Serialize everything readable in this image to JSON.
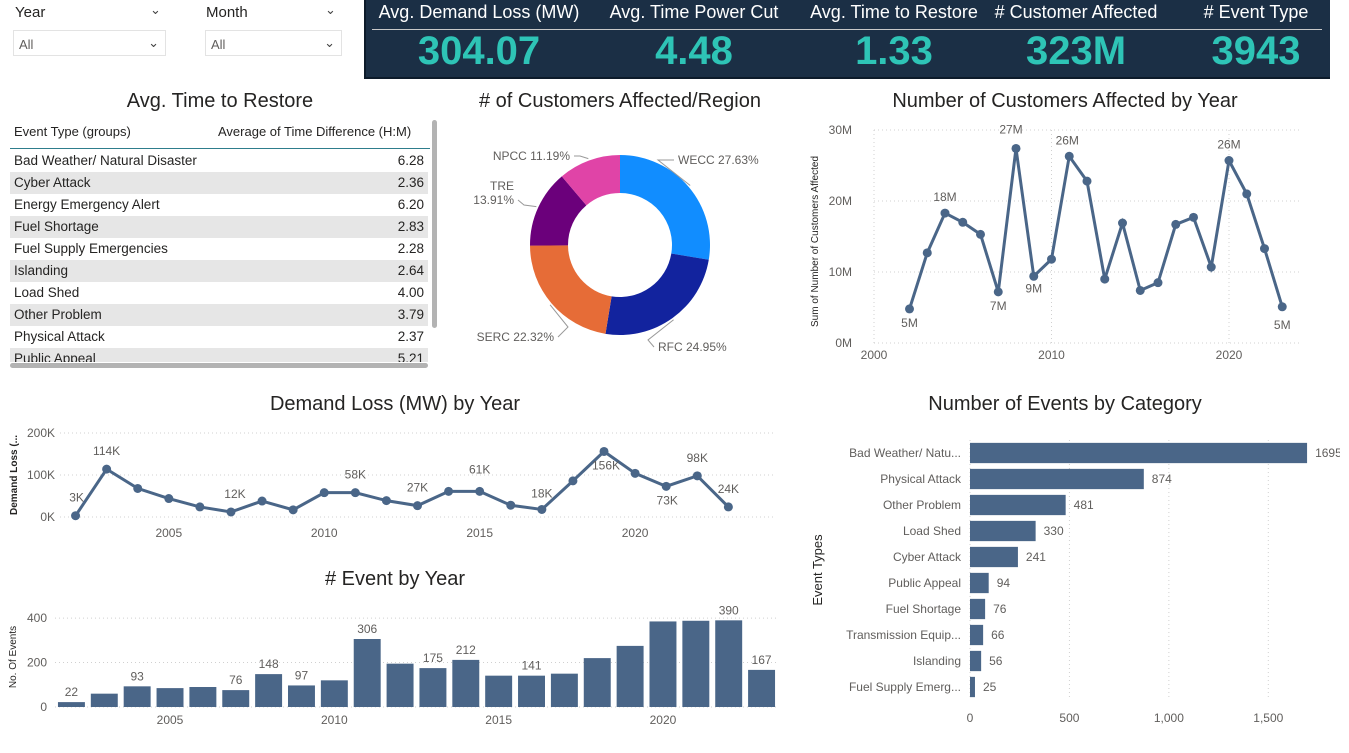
{
  "filters": {
    "year": {
      "label": "Year",
      "value": "All"
    },
    "month": {
      "label": "Month",
      "value": "All"
    }
  },
  "kpis": [
    {
      "label": "Avg. Demand Loss (MW)",
      "value": "304.07"
    },
    {
      "label": "Avg. Time Power Cut",
      "value": "4.48"
    },
    {
      "label": "Avg. Time to Restore",
      "value": "1.33"
    },
    {
      "label": "# Customer Affected",
      "value": "323M"
    },
    {
      "label": "# Event Type",
      "value": "3943"
    }
  ],
  "restore_table": {
    "title": "Avg. Time to Restore",
    "col1": "Event Type (groups)",
    "col2": "Average of Time Difference (H:M)",
    "rows": [
      {
        "name": "Bad Weather/ Natural Disaster",
        "value": "6.28"
      },
      {
        "name": "Cyber Attack",
        "value": "2.36"
      },
      {
        "name": "Energy Emergency Alert",
        "value": "6.20"
      },
      {
        "name": "Fuel Shortage",
        "value": "2.83"
      },
      {
        "name": "Fuel Supply Emergencies",
        "value": "2.28"
      },
      {
        "name": "Islanding",
        "value": "2.64"
      },
      {
        "name": "Load Shed",
        "value": "4.00"
      },
      {
        "name": "Other Problem",
        "value": "3.79"
      },
      {
        "name": "Physical Attack",
        "value": "2.37"
      },
      {
        "name": "Public Appeal",
        "value": "5.21"
      }
    ]
  },
  "chart_data": [
    {
      "id": "region_donut",
      "type": "pie",
      "title": "# of Customers Affected/Region",
      "slices": [
        {
          "name": "WECC",
          "label": "WECC 27.63%",
          "value": 27.63,
          "color": "#118dff"
        },
        {
          "name": "RFC",
          "label": "RFC 24.95%",
          "value": 24.95,
          "color": "#12239e"
        },
        {
          "name": "SERC",
          "label": "SERC 22.32%",
          "value": 22.32,
          "color": "#e66c37"
        },
        {
          "name": "TRE",
          "label": "TRE 13.91%",
          "value": 13.91,
          "color": "#6b007b"
        },
        {
          "name": "NPCC",
          "label": "NPCC 11.19%",
          "value": 11.19,
          "color": "#e044a7"
        }
      ],
      "legend": "none"
    },
    {
      "id": "customers_by_year",
      "type": "line",
      "title": "Number of Customers Affected by Year",
      "xlabel": "",
      "ylabel": "Sum of Number of Customers Affected",
      "x_ticks": [
        2000,
        2010,
        2020
      ],
      "y_ticks": [
        "0M",
        "10M",
        "20M",
        "30M"
      ],
      "xlim": [
        2000,
        2024
      ],
      "ylim": [
        0,
        30
      ],
      "x": [
        2002,
        2003,
        2004,
        2005,
        2006,
        2007,
        2008,
        2009,
        2010,
        2011,
        2012,
        2013,
        2014,
        2015,
        2016,
        2017,
        2018,
        2019,
        2020,
        2021,
        2022,
        2023
      ],
      "values": [
        4.8,
        12.7,
        18.3,
        17.0,
        15.3,
        7.2,
        27.4,
        9.4,
        11.8,
        26.3,
        22.8,
        9.0,
        16.9,
        7.4,
        8.5,
        16.7,
        17.7,
        10.7,
        25.7,
        21.0,
        13.3,
        5.1
      ],
      "data_labels": [
        {
          "x": 2002,
          "text": "5M"
        },
        {
          "x": 2004,
          "text": "18M"
        },
        {
          "x": 2007,
          "text": "7M"
        },
        {
          "x": 2008,
          "text": "27M"
        },
        {
          "x": 2009,
          "text": "9M"
        },
        {
          "x": 2011,
          "text": "26M"
        },
        {
          "x": 2020,
          "text": "26M"
        },
        {
          "x": 2023,
          "text": "5M"
        }
      ],
      "color": "#4a6688"
    },
    {
      "id": "demand_loss_by_year",
      "type": "line",
      "title": "Demand Loss (MW) by Year",
      "xlabel": "",
      "ylabel": "Demand Loss (...",
      "x_ticks": [
        2005,
        2010,
        2015,
        2020
      ],
      "y_ticks": [
        "0K",
        "100K",
        "200K"
      ],
      "xlim": [
        2001.5,
        2024.5
      ],
      "ylim": [
        0,
        200
      ],
      "x": [
        2002,
        2003,
        2004,
        2005,
        2006,
        2007,
        2008,
        2009,
        2010,
        2011,
        2012,
        2013,
        2014,
        2015,
        2016,
        2017,
        2018,
        2019,
        2020,
        2021,
        2022,
        2023
      ],
      "values": [
        3,
        114,
        68,
        44,
        24,
        12,
        38,
        17,
        58,
        58,
        39,
        27,
        61,
        61,
        28,
        18,
        86,
        156,
        104,
        73,
        98,
        24
      ],
      "data_labels": [
        {
          "x": 2002,
          "text": "3K"
        },
        {
          "x": 2003,
          "text": "114K"
        },
        {
          "x": 2007,
          "text": "12K"
        },
        {
          "x": 2011,
          "text": "58K"
        },
        {
          "x": 2013,
          "text": "27K"
        },
        {
          "x": 2015,
          "text": "61K"
        },
        {
          "x": 2017,
          "text": "18K"
        },
        {
          "x": 2019,
          "text": "156K"
        },
        {
          "x": 2021,
          "text": "73K"
        },
        {
          "x": 2022,
          "text": "98K"
        },
        {
          "x": 2023,
          "text": "24K"
        }
      ],
      "color": "#4a6688"
    },
    {
      "id": "events_by_year",
      "type": "bar",
      "title": "# Event by Year",
      "xlabel": "",
      "ylabel": "No. Of Events",
      "x_ticks": [
        2005,
        2010,
        2015,
        2020
      ],
      "y_ticks": [
        "0",
        "200",
        "400"
      ],
      "ylim": [
        0,
        450
      ],
      "categories": [
        2002,
        2003,
        2004,
        2005,
        2006,
        2007,
        2008,
        2009,
        2010,
        2011,
        2012,
        2013,
        2014,
        2015,
        2016,
        2017,
        2018,
        2019,
        2020,
        2021,
        2022,
        2023
      ],
      "values": [
        22,
        60,
        93,
        85,
        90,
        76,
        148,
        97,
        120,
        306,
        195,
        175,
        212,
        141,
        141,
        150,
        220,
        275,
        385,
        388,
        390,
        167
      ],
      "data_labels": [
        {
          "x": 2002,
          "text": "22"
        },
        {
          "x": 2004,
          "text": "93"
        },
        {
          "x": 2007,
          "text": "76"
        },
        {
          "x": 2008,
          "text": "148"
        },
        {
          "x": 2009,
          "text": "97"
        },
        {
          "x": 2011,
          "text": "306"
        },
        {
          "x": 2013,
          "text": "175"
        },
        {
          "x": 2014,
          "text": "212"
        },
        {
          "x": 2016,
          "text": "141"
        },
        {
          "x": 2022,
          "text": "390"
        },
        {
          "x": 2023,
          "text": "167"
        }
      ],
      "color": "#4a6688"
    },
    {
      "id": "events_by_category",
      "type": "bar",
      "orientation": "horizontal",
      "title": "Number of Events by Category",
      "xlabel": "",
      "ylabel": "Event Types",
      "x_ticks": [
        "0",
        "500",
        "1,000",
        "1,500"
      ],
      "xlim": [
        0,
        1760
      ],
      "categories": [
        "Bad Weather/ Natu...",
        "Physical Attack",
        "Other Problem",
        "Load Shed",
        "Cyber Attack",
        "Public Appeal",
        "Fuel Shortage",
        "Transmission Equip...",
        "Islanding",
        "Fuel Supply Emerg..."
      ],
      "values": [
        1695,
        874,
        481,
        330,
        241,
        94,
        76,
        66,
        56,
        25
      ],
      "color": "#4a6688"
    }
  ]
}
